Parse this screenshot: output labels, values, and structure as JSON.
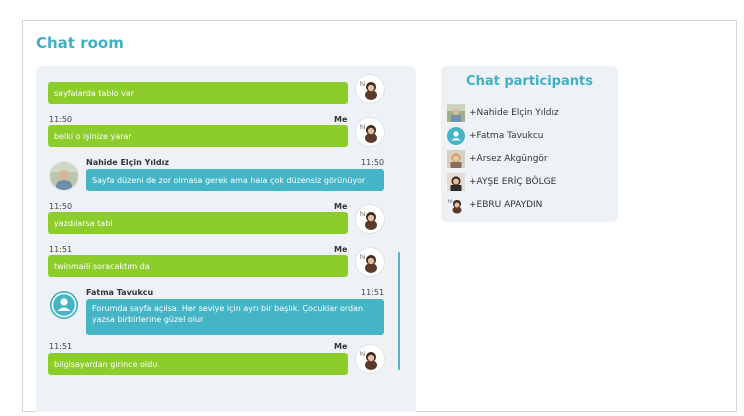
{
  "page": {
    "title": "Chat room"
  },
  "chat": {
    "messages": [
      {
        "kind": "me",
        "time": "",
        "label": "",
        "text": "sayfalarda tablo var"
      },
      {
        "kind": "me",
        "time": "11:50",
        "label": "Me",
        "text": "belki o işinize yarar"
      },
      {
        "kind": "other",
        "sender": "Nahide Elçin Yıldız",
        "time": "11:50",
        "text": "Sayfa düzeni de zor olmasa gerek ama hala çok düzensiz görünüyor"
      },
      {
        "kind": "me",
        "time": "11:50",
        "label": "Me",
        "text": "yazdılarsa tabi"
      },
      {
        "kind": "me",
        "time": "11:51",
        "label": "Me",
        "text": "twinmaili soracaktım da"
      },
      {
        "kind": "other",
        "sender": "Fatma Tavukcu",
        "time": "11:51",
        "text": "Forumda sayfa açılsa. Her seviye için ayrı bir başlık. Çocuklar ordan yazsa birbirlerine güzel olur"
      },
      {
        "kind": "me",
        "time": "11:51",
        "label": "Me",
        "text": "bilgisayardan girince oldu"
      }
    ]
  },
  "participants": {
    "title": "Chat participants",
    "items": [
      {
        "name": "+Nahide Elçin Yıldız",
        "icon": "photo-thumbnail-icon"
      },
      {
        "name": "+Fatma Tavukcu",
        "icon": "default-user-icon"
      },
      {
        "name": "+Arsez Akgüngör",
        "icon": "photo-thumbnail-icon"
      },
      {
        "name": "+AYŞE ERİÇ BÖLGE",
        "icon": "photo-thumbnail-icon"
      },
      {
        "name": "+EBRU APAYDIN",
        "icon": "cartoon-avatar-icon"
      }
    ]
  },
  "colors": {
    "accent": "#3fb1c6",
    "me_bubble": "#8ccd2b",
    "other_bubble": "#45b5c6",
    "panel": "#eef2f6"
  }
}
